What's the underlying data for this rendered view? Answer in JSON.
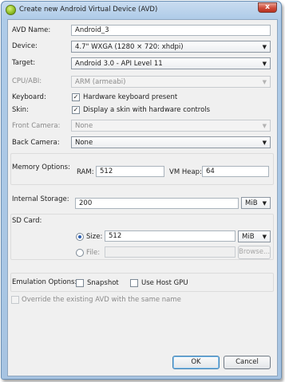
{
  "window": {
    "title": "Create new Android Virtual Device (AVD)",
    "close": "x"
  },
  "form": {
    "avd_name": {
      "label": "AVD Name:",
      "value": "Android_3"
    },
    "device": {
      "label": "Device:",
      "value": "4.7\" WXGA (1280 × 720: xhdpi)"
    },
    "target": {
      "label": "Target:",
      "value": "Android 3.0 - API Level 11"
    },
    "cpu_abi": {
      "label": "CPU/ABI:",
      "value": "ARM (armeabi)"
    },
    "keyboard": {
      "label": "Keyboard:",
      "option": "Hardware keyboard present",
      "checked": true
    },
    "skin": {
      "label": "Skin:",
      "option": "Display a skin with hardware controls",
      "checked": true
    },
    "front_camera": {
      "label": "Front Camera:",
      "value": "None"
    },
    "back_camera": {
      "label": "Back Camera:",
      "value": "None"
    },
    "memory": {
      "label": "Memory Options:",
      "ram_label": "RAM:",
      "ram_value": "512",
      "vmheap_label": "VM Heap:",
      "vmheap_value": "64"
    },
    "internal_storage": {
      "label": "Internal Storage:",
      "value": "200",
      "unit": "MiB"
    },
    "sd_card": {
      "label": "SD Card:",
      "size_label": "Size:",
      "size_value": "512",
      "size_unit": "MiB",
      "size_selected": true,
      "file_label": "File:",
      "file_value": "",
      "browse_label": "Browse..."
    },
    "emulation": {
      "label": "Emulation Options:",
      "snapshot_label": "Snapshot",
      "snapshot_checked": false,
      "gpu_label": "Use Host GPU",
      "gpu_checked": false
    },
    "override": {
      "label": "Override the existing AVD with the same name",
      "checked": false
    }
  },
  "buttons": {
    "ok": "OK",
    "cancel": "Cancel"
  },
  "icons": {
    "checkmark": "✓",
    "dropdown": "▼"
  },
  "colors": {
    "accent": "#2a5db0",
    "titlebar": "#aecbe8",
    "close": "#cf4c3a"
  }
}
